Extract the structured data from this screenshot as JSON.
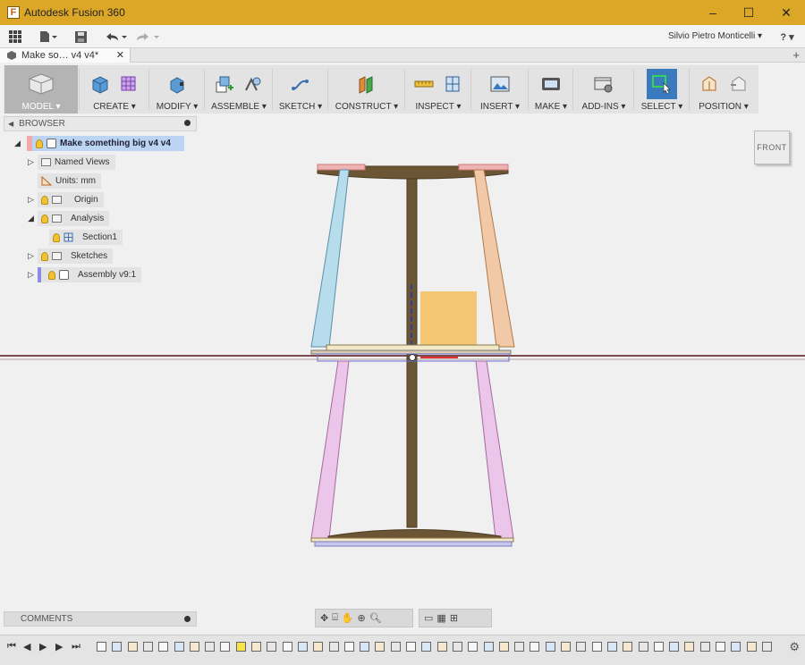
{
  "window": {
    "title": "Autodesk Fusion 360",
    "minimize": "–",
    "maximize": "☐",
    "close": "✕"
  },
  "qat": {
    "user_name": "Silvio Pietro Monticelli ▾",
    "help": "? ▾"
  },
  "tab": {
    "doc_title": "Make so… v4 v4*",
    "close": "✕",
    "new_tab": "+"
  },
  "ribbon": {
    "workspace": "MODEL ▾",
    "groups": [
      "CREATE ▾",
      "MODIFY ▾",
      "ASSEMBLE ▾",
      "SKETCH ▾",
      "CONSTRUCT ▾",
      "INSPECT ▾",
      "INSERT ▾",
      "MAKE ▾",
      "ADD-INS ▾",
      "SELECT ▾",
      "POSITION ▾"
    ]
  },
  "browser": {
    "header": "BROWSER",
    "root": "Make something big v4 v4",
    "items": {
      "named_views": "Named Views",
      "units": "Units: mm",
      "origin": "Origin",
      "analysis": "Analysis",
      "section": "Section1",
      "sketches": "Sketches",
      "assembly": "Assembly v9:1"
    }
  },
  "comments": {
    "label": "COMMENTS"
  },
  "viewcube": {
    "face": "FRONT"
  },
  "colors": {
    "title_bar": "#dca726",
    "wood": "#6b5534",
    "blue_leg": "#b7dcec",
    "peach_leg": "#f2c9a6",
    "pink_leg": "#ecc5ea",
    "section_box": "#f6bf5e",
    "select_highlight": "#3a7bbf",
    "root_highlight": "#bcd4f4"
  },
  "icons": [
    "grid-icon",
    "file-icon",
    "save-icon",
    "undo-icon",
    "redo-icon",
    "help-icon",
    "box-icon",
    "grid-sphere-icon",
    "press-pull-icon",
    "new-component-icon",
    "joint-icon",
    "sketch-curve-icon",
    "offset-plane-icon",
    "measure-icon",
    "section-analysis-icon",
    "insert-image-icon",
    "make-icon",
    "scripts-icon",
    "select-icon",
    "capture-position-icon",
    "revert-position-icon",
    "orbit-icon",
    "look-at-icon",
    "pan-icon",
    "zoom-window-icon",
    "zoom-icon",
    "display-settings-icon",
    "grid-settings-icon",
    "viewports-icon",
    "gear-icon"
  ]
}
